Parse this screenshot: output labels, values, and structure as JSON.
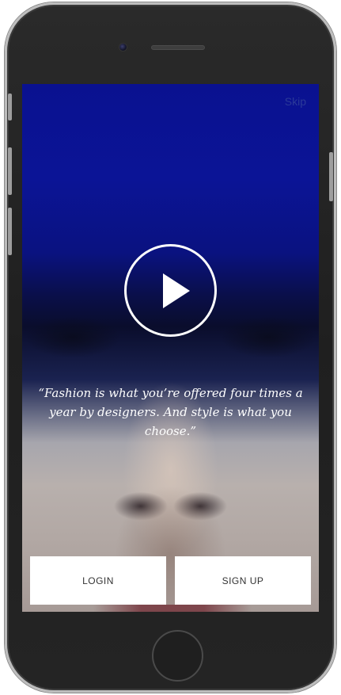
{
  "screen": {
    "skip_label": "Skip",
    "quote": "“Fashion is what you’re offered four times a year by designers. And style is what you choose.”",
    "login_label": "LOGIN",
    "signup_label": "SIGN UP",
    "play_icon": "play-icon"
  },
  "colors": {
    "background_top": "#0a1190",
    "skip_text": "#2b3a99",
    "button_background": "#ffffff",
    "button_text": "#333333",
    "device_body": "#242424"
  }
}
